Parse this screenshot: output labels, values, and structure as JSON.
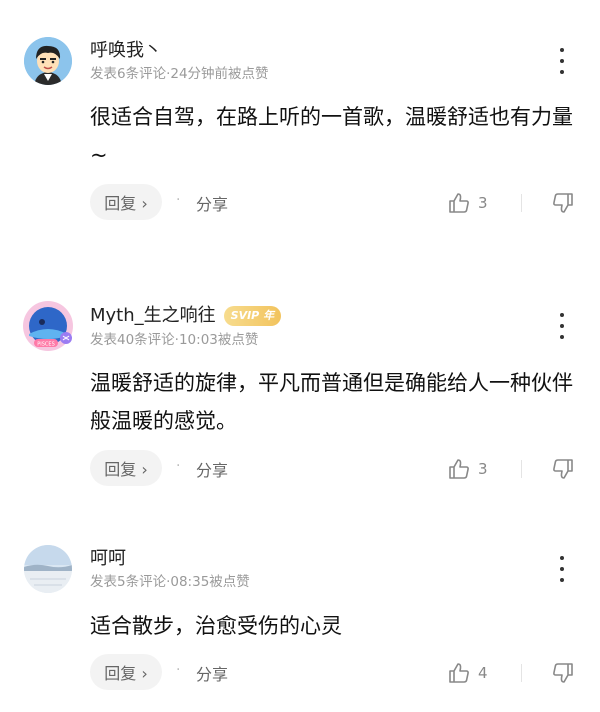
{
  "comments": [
    {
      "name": "呼唤我丶",
      "meta": "发表6条评论·24分钟前被点赞",
      "text": "很适合自驾，在路上听的一首歌，温暖舒适也有力量~",
      "reply_label": "回复 ›",
      "separator": "·",
      "share_label": "分享",
      "likes": "3",
      "avatar_icon": "cartoon-boy-avatar"
    },
    {
      "name": "Myth_生之响往",
      "badge": "SVIP 年",
      "meta": "发表40条评论·10:03被点赞",
      "text": "温暖舒适的旋律，平凡而普通但是确能给人一种伙伴般温暖的感觉。",
      "reply_label": "回复 ›",
      "separator": "·",
      "share_label": "分享",
      "likes": "3",
      "avatar_icon": "pisces-avatar",
      "avatar_caption": "PISCES"
    },
    {
      "name": "呵呵",
      "meta": "发表5条评论·08:35被点赞",
      "text": "适合散步，治愈受伤的心灵",
      "reply_label": "回复 ›",
      "separator": "·",
      "share_label": "分享",
      "likes": "4",
      "avatar_icon": "landscape-avatar"
    }
  ]
}
